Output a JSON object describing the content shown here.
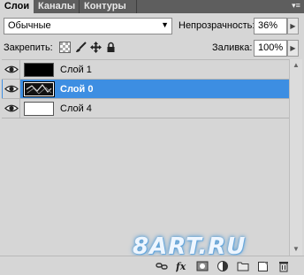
{
  "tabs": [
    {
      "label": "Слои",
      "active": true
    },
    {
      "label": "Каналы",
      "active": false
    },
    {
      "label": "Контуры",
      "active": false
    }
  ],
  "blend_mode": {
    "value": "Обычные"
  },
  "opacity": {
    "label": "Непрозрачность:",
    "value": "36%"
  },
  "lock": {
    "label": "Закрепить:"
  },
  "fill": {
    "label": "Заливка:",
    "value": "100%"
  },
  "layers": [
    {
      "name": "Слой 1",
      "visible": true,
      "selected": false,
      "thumb": "black"
    },
    {
      "name": "Слой 0",
      "visible": true,
      "selected": true,
      "thumb": "image"
    },
    {
      "name": "Слой 4",
      "visible": true,
      "selected": false,
      "thumb": "white"
    }
  ],
  "watermark": "8ART.RU",
  "colors": {
    "selection": "#3d8ee2",
    "panel_bg": "#d6d6d6",
    "tab_strip": "#5e5e5e"
  },
  "bottom_tools": [
    "link-icon",
    "fx-icon",
    "mask-icon",
    "adjustment-icon",
    "folder-icon",
    "new-layer-icon",
    "trash-icon"
  ]
}
